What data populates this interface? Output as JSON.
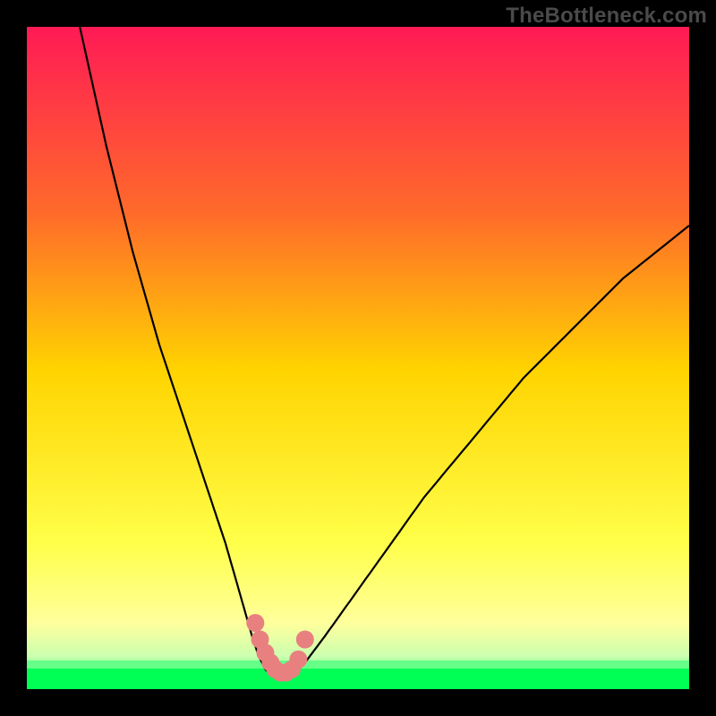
{
  "attribution": "TheBottleneck.com",
  "colors": {
    "frame": "#000000",
    "attribution_text": "#4a4a4a",
    "curve": "#000000",
    "marker_fill": "#e88080",
    "marker_stroke": "#c96060",
    "green_band": "#00ff66",
    "gradient_top": "#ff1a55",
    "gradient_mid": "#ffd400",
    "gradient_low": "#ffff8c",
    "gradient_bottom": "#00ff66"
  },
  "chart_data": {
    "type": "line",
    "title": "",
    "xlabel": "",
    "ylabel": "",
    "xlim": [
      0,
      100
    ],
    "ylim": [
      0,
      100
    ],
    "series": [
      {
        "name": "left-branch",
        "x": [
          8,
          12,
          16,
          20,
          24,
          28,
          30,
          32,
          34,
          35,
          36,
          37
        ],
        "y": [
          100,
          82,
          66,
          52,
          40,
          28,
          22,
          15,
          8,
          5,
          3,
          2
        ]
      },
      {
        "name": "right-branch",
        "x": [
          40,
          42,
          45,
          50,
          55,
          60,
          65,
          70,
          75,
          80,
          85,
          90,
          95,
          100
        ],
        "y": [
          2,
          4,
          8,
          15,
          22,
          29,
          35,
          41,
          47,
          52,
          57,
          62,
          66,
          70
        ]
      }
    ],
    "markers": {
      "name": "highlight-dots",
      "x": [
        34.5,
        35.2,
        36.0,
        36.8,
        37.5,
        38.3,
        39.1,
        40.0,
        41.0,
        42.0
      ],
      "y": [
        10.0,
        7.5,
        5.5,
        4.0,
        3.0,
        2.5,
        2.5,
        3.0,
        4.5,
        7.5
      ]
    },
    "green_threshold_y": 3.5
  }
}
